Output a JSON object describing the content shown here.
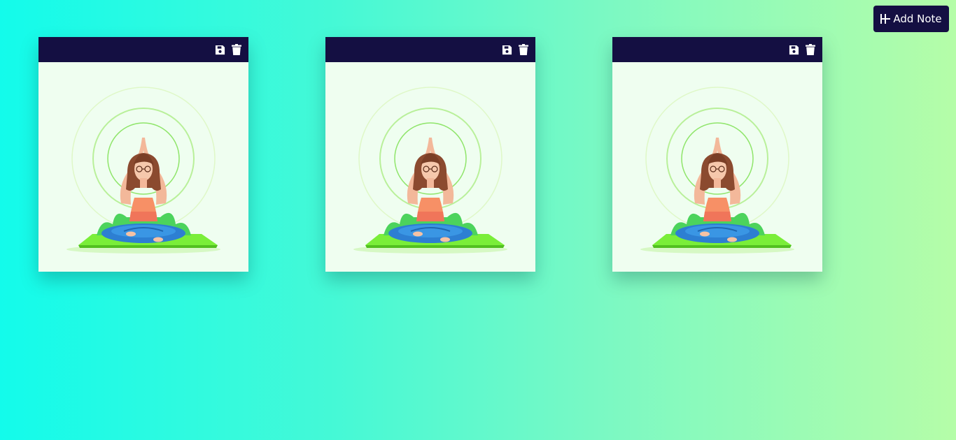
{
  "toolbar": {
    "add_note_label": "Add Note",
    "add_note_icon": "plus-icon",
    "button_bg": "#140f42"
  },
  "notes": [
    {
      "actions": [
        "save-icon",
        "trash-icon"
      ],
      "image": "meditating-woman-illustration"
    },
    {
      "actions": [
        "save-icon",
        "trash-icon"
      ],
      "image": "meditating-woman-illustration"
    },
    {
      "actions": [
        "save-icon",
        "trash-icon"
      ],
      "image": "meditating-woman-illustration"
    }
  ],
  "colors": {
    "note_header": "#140f42",
    "note_body": "#effef0",
    "background_start": "#13fbeb",
    "background_end": "#b5fda8"
  }
}
